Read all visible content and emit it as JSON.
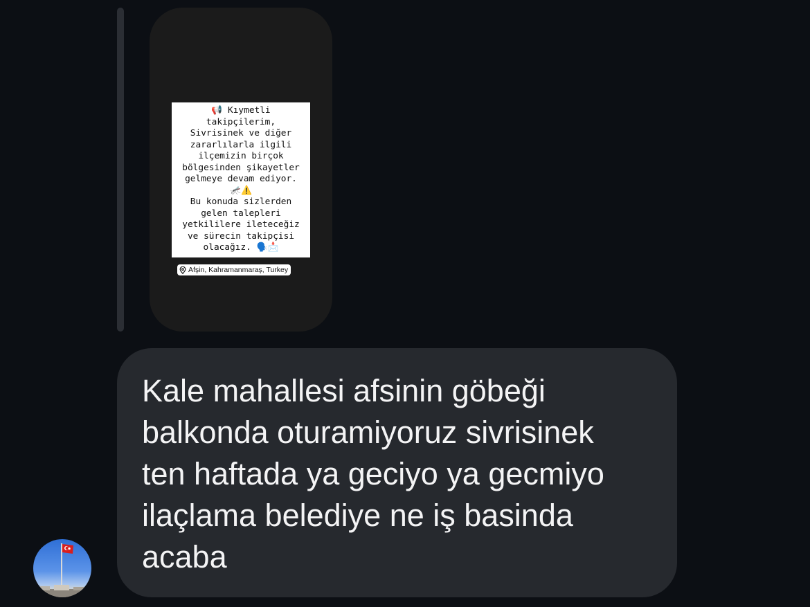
{
  "story": {
    "note_lines": [
      "📢 Kıymetli",
      "takipçilerim,",
      "Sivrisinek ve diğer",
      "zararlılarla ilgili",
      "ilçemizin birçok",
      "bölgesinden şikayetler",
      "gelmeye devam ediyor.",
      "🦟⚠️",
      "Bu konuda sizlerden",
      "gelen talepleri",
      "yetkililere ileteceğiz",
      "ve sürecin takipçisi",
      "olacağız. 🗣️📩"
    ],
    "location": "Afşin, Kahramanmaraş, Turkey",
    "location_icon": "location-pin-icon"
  },
  "message": {
    "lines": [
      "Kale mahallesi afsinin göbeği",
      "balkonda oturamiyoruz sivrisinek",
      "ten haftada ya geciyo ya gecmiyo",
      "ilaçlama belediye ne iş basinda",
      "acaba"
    ]
  },
  "colors": {
    "background": "#0c0f14",
    "bubble": "#26292e",
    "story_card": "#1b1b1b",
    "reply_bar": "#2b2e34",
    "text": "#f4f4f5"
  }
}
